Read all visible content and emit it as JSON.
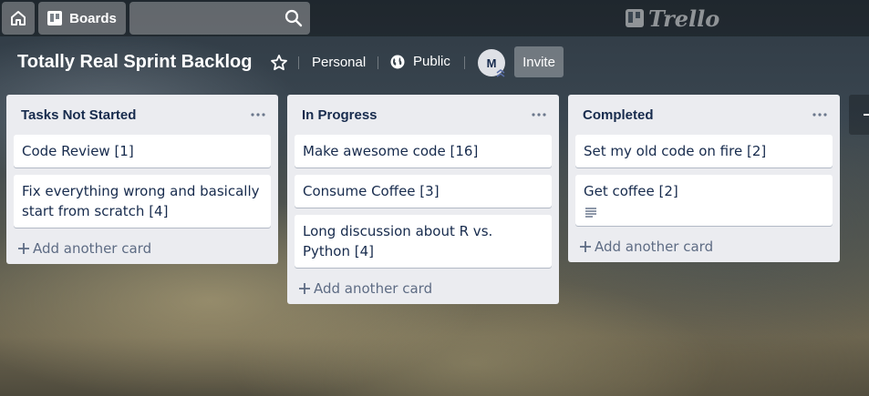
{
  "nav": {
    "boards_label": "Boards",
    "search_placeholder": "",
    "logo_text": "Trello"
  },
  "board": {
    "title": "Totally Real Sprint Backlog",
    "team_label": "Personal",
    "visibility_label": "Public",
    "member_initial": "M",
    "invite_label": "Invite"
  },
  "lists": [
    {
      "title": "Tasks Not Started",
      "cards": [
        {
          "text": "Code Review [1]"
        },
        {
          "text": "Fix everything wrong and basically start from scratch [4]"
        }
      ],
      "add_label": "Add another card"
    },
    {
      "title": "In Progress",
      "cards": [
        {
          "text": "Make awesome code [16]"
        },
        {
          "text": "Consume Coffee [3]"
        },
        {
          "text": "Long discussion about R vs. Python [4]"
        }
      ],
      "add_label": "Add another card"
    },
    {
      "title": "Completed",
      "cards": [
        {
          "text": "Set my old code on fire [2]"
        },
        {
          "text": "Get coffee [2]",
          "has_description": true
        }
      ],
      "add_label": "Add another card"
    }
  ],
  "icons": {
    "home": "home-icon",
    "boards": "boards-icon",
    "search": "search-icon",
    "star": "star-icon",
    "public": "globe-icon",
    "list_menu": "more-horizontal-icon",
    "description": "description-icon",
    "add": "plus-icon"
  },
  "colors": {
    "list_bg": "#ebecf0",
    "card_text": "#172b4d",
    "muted_text": "#5e6c84"
  }
}
